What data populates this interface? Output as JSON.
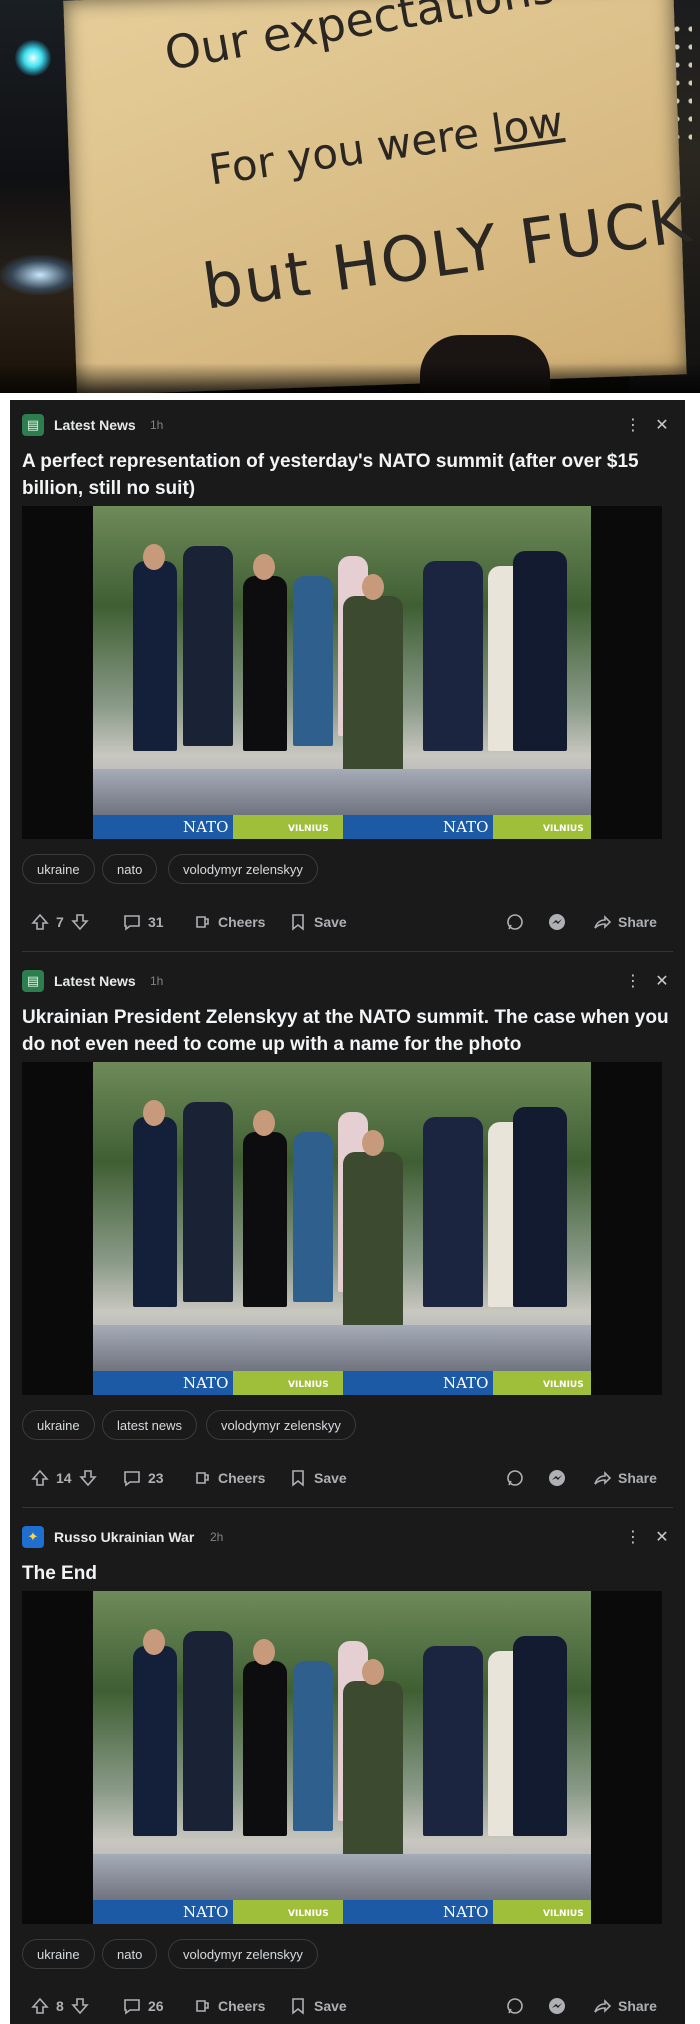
{
  "meme": {
    "line1": "Our expectations",
    "line2a": "For you were ",
    "line2b": "low",
    "line3": "but HOLY FUCK"
  },
  "posts": [
    {
      "community": "Latest News",
      "time": "1h",
      "title": "A perfect representation of yesterday's NATO summit (after over $15 billion, still no suit)",
      "tags": [
        "ukraine",
        "nato",
        "volodymyr zelenskyy"
      ],
      "votes": "7",
      "comments": "31",
      "cheers": "Cheers",
      "save": "Save",
      "share": "Share"
    },
    {
      "community": "Latest News",
      "time": "1h",
      "title": "Ukrainian President Zelenskyy at the NATO summit. The case when you do not even need to come up with a name for the photo",
      "tags": [
        "ukraine",
        "latest news",
        "volodymyr zelenskyy"
      ],
      "votes": "14",
      "comments": "23",
      "cheers": "Cheers",
      "save": "Save",
      "share": "Share"
    },
    {
      "community": "Russo Ukrainian War",
      "time": "2h",
      "title": "The End",
      "tags": [
        "ukraine",
        "nato",
        "volodymyr zelenskyy"
      ],
      "votes": "8",
      "comments": "26",
      "cheers": "Cheers",
      "save": "Save",
      "share": "Share"
    }
  ],
  "photo": {
    "banner_a": "NATO",
    "banner_b": "VILNIUS"
  },
  "colors": {
    "feed_bg": "#1a1a1b",
    "latest_news_icon": "#2e7d4f",
    "russo_icon": "#1f6fd1",
    "tag_border": "#3a3b3d"
  }
}
